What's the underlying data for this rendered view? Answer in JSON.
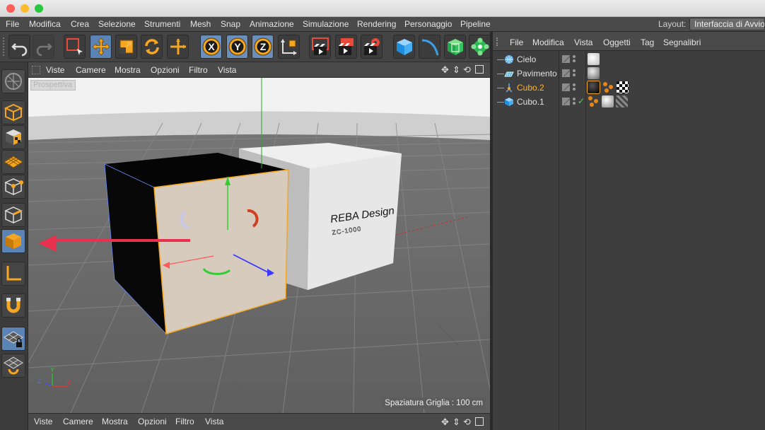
{
  "window": {
    "traffic_lights": [
      "#fc5f57",
      "#fdbc2e",
      "#28c840"
    ]
  },
  "menubar": {
    "items": [
      "File",
      "Modifica",
      "Crea",
      "Selezione",
      "Strumenti",
      "Mesh",
      "Snap",
      "Animazione",
      "Simulazione",
      "Rendering",
      "Personaggio",
      "Pipeline"
    ],
    "layout_label": "Layout:",
    "layout_value": "Interfaccia di Avvio"
  },
  "toolbar": {
    "buttons": [
      "undo-icon",
      "redo-icon",
      "live-selection-icon",
      "move-icon",
      "scale-icon",
      "rotate-icon",
      "add-icon",
      "x-axis-icon",
      "y-axis-icon",
      "z-axis-icon",
      "coordinate-system-icon",
      "render-view-icon",
      "render-picture-queue-icon",
      "render-settings-icon",
      "cube-primitive-icon",
      "spline-icon",
      "generator-icon",
      "deformer-icon"
    ],
    "axis_letters": [
      "X",
      "Y",
      "Z"
    ]
  },
  "left_tools": [
    "make-editable-icon",
    "model-mode-icon",
    "texture-mode-icon",
    "workplane-icon",
    "points-mode-icon",
    "edges-mode-icon",
    "polygons-mode-icon",
    "axis-mode-icon",
    "magnet-icon",
    "locked-workplane-icon",
    "snap-workplane-icon"
  ],
  "viewport": {
    "menu": [
      "Viste",
      "Camere",
      "Mostra",
      "Opzioni",
      "Filtro",
      "Vista"
    ],
    "camera_label": "Prospettiva",
    "grid_spacing": "Spaziatura Griglia : 100 cm",
    "cube_text": "REBA Design",
    "cube_code": "ZC-1000",
    "axis_letters": [
      "Y",
      "Z",
      "X"
    ]
  },
  "viewport_footer": {
    "menu": [
      "Viste",
      "Camere",
      "Mostra",
      "Opzioni",
      "Filtro",
      "Vista"
    ]
  },
  "object_manager": {
    "menu": [
      "File",
      "Modifica",
      "Vista",
      "Oggetti",
      "Tag",
      "Segnalibri"
    ],
    "objects": [
      {
        "name": "Cielo",
        "icon": "sky-icon",
        "selected": false
      },
      {
        "name": "Pavimento",
        "icon": "floor-icon",
        "selected": false
      },
      {
        "name": "Cubo.2",
        "icon": "null-icon",
        "selected": true
      },
      {
        "name": "Cubo.1",
        "icon": "cube-icon",
        "selected": false
      }
    ]
  },
  "colors": {
    "accent_blue": "#5b84b4",
    "selected_text": "#ffb52e",
    "arrow": "#e8304f",
    "tool_orange": "#f5a623"
  }
}
